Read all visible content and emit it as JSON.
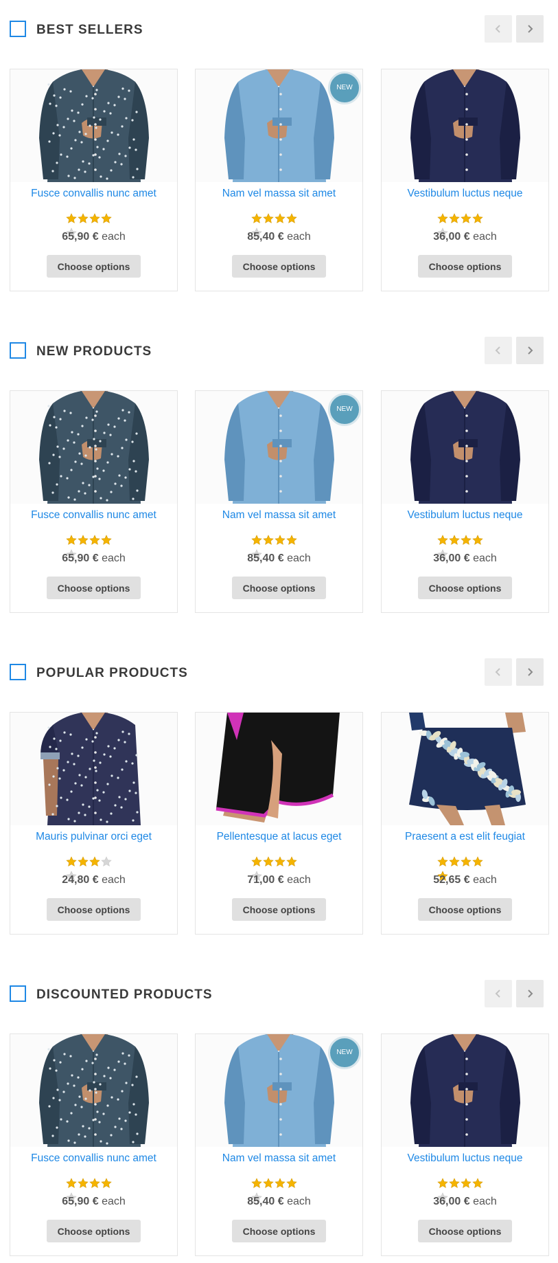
{
  "sections": [
    {
      "title": "BEST SELLERS",
      "products": [
        {
          "name": "Fusce convallis nunc amet",
          "price": "65,90 €",
          "unit": "each",
          "rating": 4,
          "badge": "",
          "image": "patterned-shirt",
          "button": "Choose options"
        },
        {
          "name": "Nam vel massa sit amet",
          "price": "85,40 €",
          "unit": "each",
          "rating": 4,
          "badge": "NEW",
          "image": "denim-shirt",
          "button": "Choose options"
        },
        {
          "name": "Vestibulum luctus neque",
          "price": "36,00 €",
          "unit": "each",
          "rating": 4,
          "badge": "",
          "image": "navy-shirt",
          "button": "Choose options"
        }
      ]
    },
    {
      "title": "NEW PRODUCTS",
      "products": [
        {
          "name": "Fusce convallis nunc amet",
          "price": "65,90 €",
          "unit": "each",
          "rating": 4,
          "badge": "",
          "image": "patterned-shirt",
          "button": "Choose options"
        },
        {
          "name": "Nam vel massa sit amet",
          "price": "85,40 €",
          "unit": "each",
          "rating": 4,
          "badge": "NEW",
          "image": "denim-shirt",
          "button": "Choose options"
        },
        {
          "name": "Vestibulum luctus neque",
          "price": "36,00 €",
          "unit": "each",
          "rating": 4,
          "badge": "",
          "image": "navy-shirt",
          "button": "Choose options"
        }
      ]
    },
    {
      "title": "POPULAR PRODUCTS",
      "products": [
        {
          "name": "Mauris pulvinar orci eget",
          "price": "24,80 €",
          "unit": "each",
          "rating": 3,
          "badge": "",
          "image": "short-sleeve-shirt",
          "button": "Choose options"
        },
        {
          "name": "Pellentesque at lacus eget",
          "price": "71,00 €",
          "unit": "each",
          "rating": 4,
          "badge": "",
          "image": "black-shorts",
          "button": "Choose options"
        },
        {
          "name": "Praesent a est elit feugiat",
          "price": "52,65 €",
          "unit": "each",
          "rating": 5,
          "badge": "",
          "image": "floral-skirt",
          "button": "Choose options"
        }
      ]
    },
    {
      "title": "DISCOUNTED PRODUCTS",
      "products": [
        {
          "name": "Fusce convallis nunc amet",
          "price": "65,90 €",
          "unit": "each",
          "rating": 4,
          "badge": "",
          "image": "patterned-shirt",
          "button": "Choose options"
        },
        {
          "name": "Nam vel massa sit amet",
          "price": "85,40 €",
          "unit": "each",
          "rating": 4,
          "badge": "NEW",
          "image": "denim-shirt",
          "button": "Choose options"
        },
        {
          "name": "Vestibulum luctus neque",
          "price": "36,00 €",
          "unit": "each",
          "rating": 4,
          "badge": "",
          "image": "navy-shirt",
          "button": "Choose options"
        }
      ]
    }
  ],
  "icons": {
    "prev": "chevron-left-icon",
    "next": "chevron-right-icon",
    "star": "star-icon"
  },
  "colors": {
    "accent": "#1e88e5",
    "badge": "#5a9fbb",
    "star": "#f5b400",
    "star_empty": "#d6d6d6",
    "button_bg": "#e0e0e0"
  }
}
